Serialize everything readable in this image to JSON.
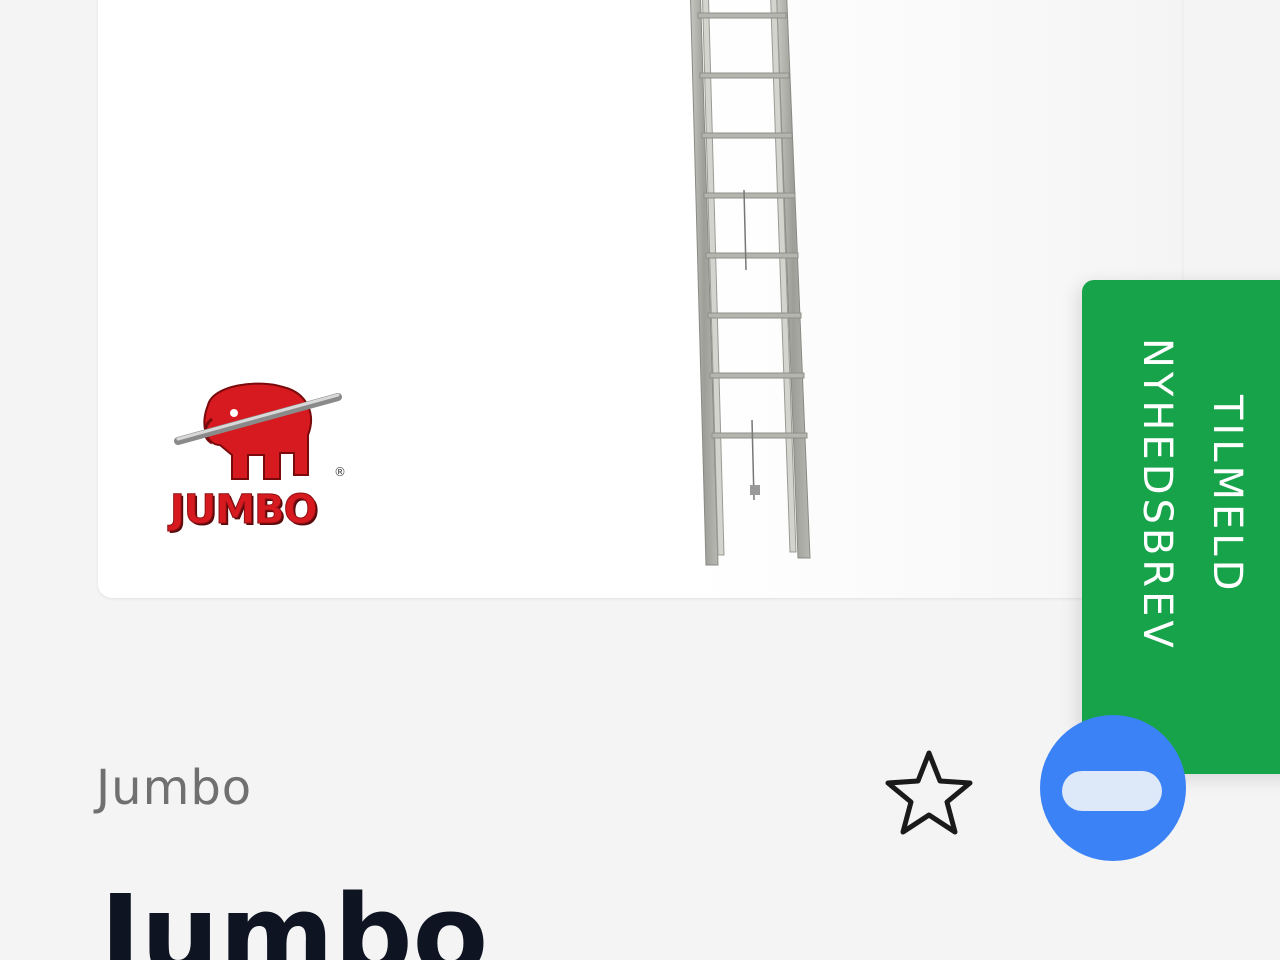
{
  "product": {
    "brand": "Jumbo",
    "title": "Jumbo",
    "image_alt_icon": "ladder-image"
  },
  "logo": {
    "text": "JUMBO",
    "registered": "®",
    "color": "#d61a1f"
  },
  "newsletter": {
    "label": "TILMELD\nNYHEDSBREV",
    "color": "#17a34a"
  },
  "actions": {
    "favorite_icon": "star-outline-icon",
    "chat_icon": "chat-icon",
    "chat_color": "#3b82f6"
  }
}
